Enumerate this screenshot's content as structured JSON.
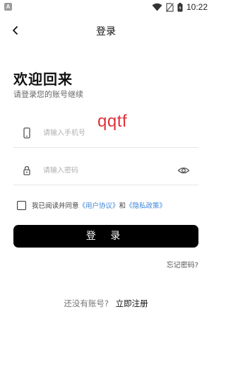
{
  "status_bar": {
    "app_icon_letter": "A",
    "time": "10:22"
  },
  "header": {
    "title": "登录",
    "back_icon": "chevron-left-icon"
  },
  "welcome": {
    "title": "欢迎回来",
    "subtitle": "请登录您的账号继续"
  },
  "overlay_text": "qqtf",
  "phone_field": {
    "placeholder": "请输入手机号",
    "value": "",
    "icon": "phone-icon"
  },
  "password_field": {
    "placeholder": "请输入密码",
    "value": "",
    "icon": "lock-icon",
    "toggle_icon": "eye-icon"
  },
  "agreement": {
    "checked": false,
    "prefix": "我已阅读并同意",
    "user_agreement": "《用户协议》",
    "joiner": "和",
    "privacy_policy": "《隐私政策》",
    "link_color": "#3a86d8"
  },
  "login_button": {
    "label": "登 录",
    "bg_color": "#000000"
  },
  "forgot_password": "忘记密码?",
  "register": {
    "question": "还没有账号?",
    "link": "立即注册"
  }
}
